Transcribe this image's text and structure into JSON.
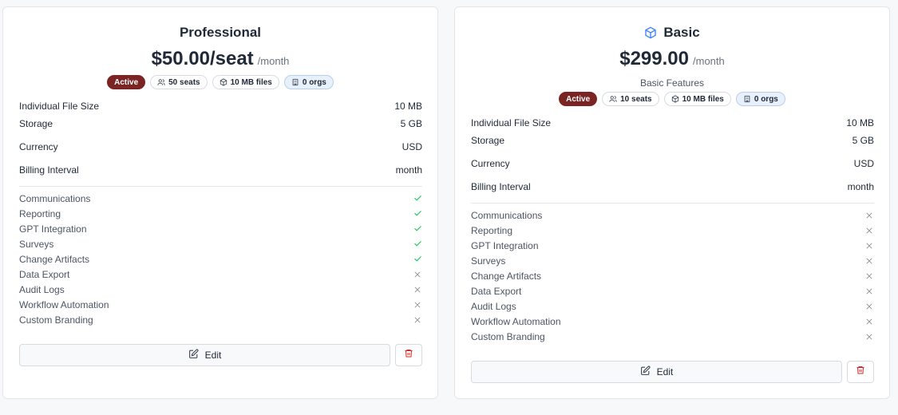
{
  "colors": {
    "check": "#22c55e",
    "cross": "#8a8f98",
    "active_badge": "#7a2424",
    "delete": "#dc2626",
    "box_icon": "#3b82f6"
  },
  "plans": [
    {
      "title": "Professional",
      "price": "$50.00/seat",
      "per": "/month",
      "description": "",
      "badges": {
        "active": "Active",
        "seats": "50 seats",
        "files": "10 MB files",
        "orgs": "0 orgs"
      },
      "specs": [
        {
          "label": "Individual File Size",
          "value": "10 MB"
        },
        {
          "label": "Storage",
          "value": "5 GB"
        },
        {
          "label": "Currency",
          "value": "USD"
        },
        {
          "label": "Billing Interval",
          "value": "month"
        }
      ],
      "features": [
        {
          "label": "Communications",
          "enabled": true
        },
        {
          "label": "Reporting",
          "enabled": true
        },
        {
          "label": "GPT Integration",
          "enabled": true
        },
        {
          "label": "Surveys",
          "enabled": true
        },
        {
          "label": "Change Artifacts",
          "enabled": true
        },
        {
          "label": "Data Export",
          "enabled": false
        },
        {
          "label": "Audit Logs",
          "enabled": false
        },
        {
          "label": "Workflow Automation",
          "enabled": false
        },
        {
          "label": "Custom Branding",
          "enabled": false
        }
      ],
      "edit_label": "Edit"
    },
    {
      "title": "Basic",
      "price": "$299.00",
      "per": "/month",
      "description": "Basic Features",
      "badges": {
        "active": "Active",
        "seats": "10 seats",
        "files": "10 MB files",
        "orgs": "0 orgs"
      },
      "specs": [
        {
          "label": "Individual File Size",
          "value": "10 MB"
        },
        {
          "label": "Storage",
          "value": "5 GB"
        },
        {
          "label": "Currency",
          "value": "USD"
        },
        {
          "label": "Billing Interval",
          "value": "month"
        }
      ],
      "features": [
        {
          "label": "Communications",
          "enabled": false
        },
        {
          "label": "Reporting",
          "enabled": false
        },
        {
          "label": "GPT Integration",
          "enabled": false
        },
        {
          "label": "Surveys",
          "enabled": false
        },
        {
          "label": "Change Artifacts",
          "enabled": false
        },
        {
          "label": "Data Export",
          "enabled": false
        },
        {
          "label": "Audit Logs",
          "enabled": false
        },
        {
          "label": "Workflow Automation",
          "enabled": false
        },
        {
          "label": "Custom Branding",
          "enabled": false
        }
      ],
      "edit_label": "Edit"
    }
  ]
}
